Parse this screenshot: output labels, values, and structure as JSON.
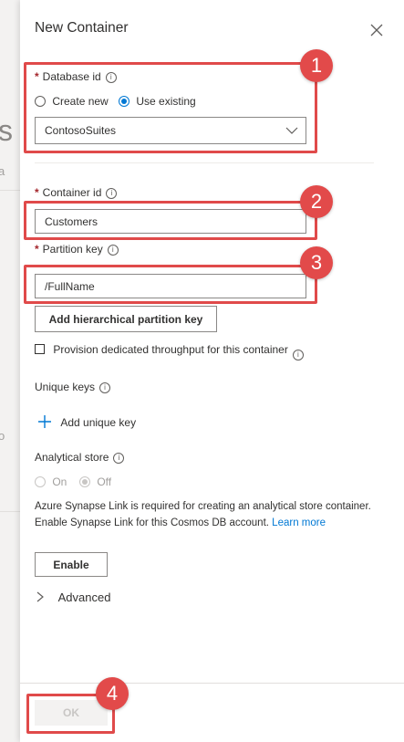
{
  "panel": {
    "title": "New Container",
    "close_icon": "close-icon"
  },
  "background": {
    "glyph_a": "s",
    "glyph_b": "a",
    "glyph_c": "o"
  },
  "database": {
    "label": "Database id",
    "required_mark": "*",
    "info_icon": "i",
    "radio_create": "Create new",
    "radio_existing": "Use existing",
    "selected_option": "Use existing",
    "dropdown_value": "ContosoSuites"
  },
  "container": {
    "label": "Container id",
    "required_mark": "*",
    "info_icon": "i",
    "value": "Customers"
  },
  "partition": {
    "label": "Partition key",
    "required_mark": "*",
    "info_icon": "i",
    "value": "/FullName",
    "hierarchical_button": "Add hierarchical partition key"
  },
  "throughput": {
    "checkbox_label": "Provision dedicated throughput for this container",
    "checked": false,
    "info_icon": "i"
  },
  "unique_keys": {
    "label": "Unique keys",
    "info_icon": "i",
    "add_label": "Add unique key"
  },
  "analytical": {
    "label": "Analytical store",
    "info_icon": "i",
    "on_label": "On",
    "off_label": "Off",
    "selected": "Off",
    "message": "Azure Synapse Link is required for creating an analytical store container. Enable Synapse Link for this Cosmos DB account.",
    "link_text": "Learn more",
    "enable_button": "Enable"
  },
  "advanced": {
    "label": "Advanced"
  },
  "footer": {
    "ok_button": "OK"
  },
  "annotations": [
    {
      "number": "1"
    },
    {
      "number": "2"
    },
    {
      "number": "3"
    },
    {
      "number": "4"
    }
  ],
  "colors": {
    "accent": "#0078d4",
    "required": "#a4262c",
    "highlight": "#e04a4a",
    "badge": "#e24a4a"
  }
}
